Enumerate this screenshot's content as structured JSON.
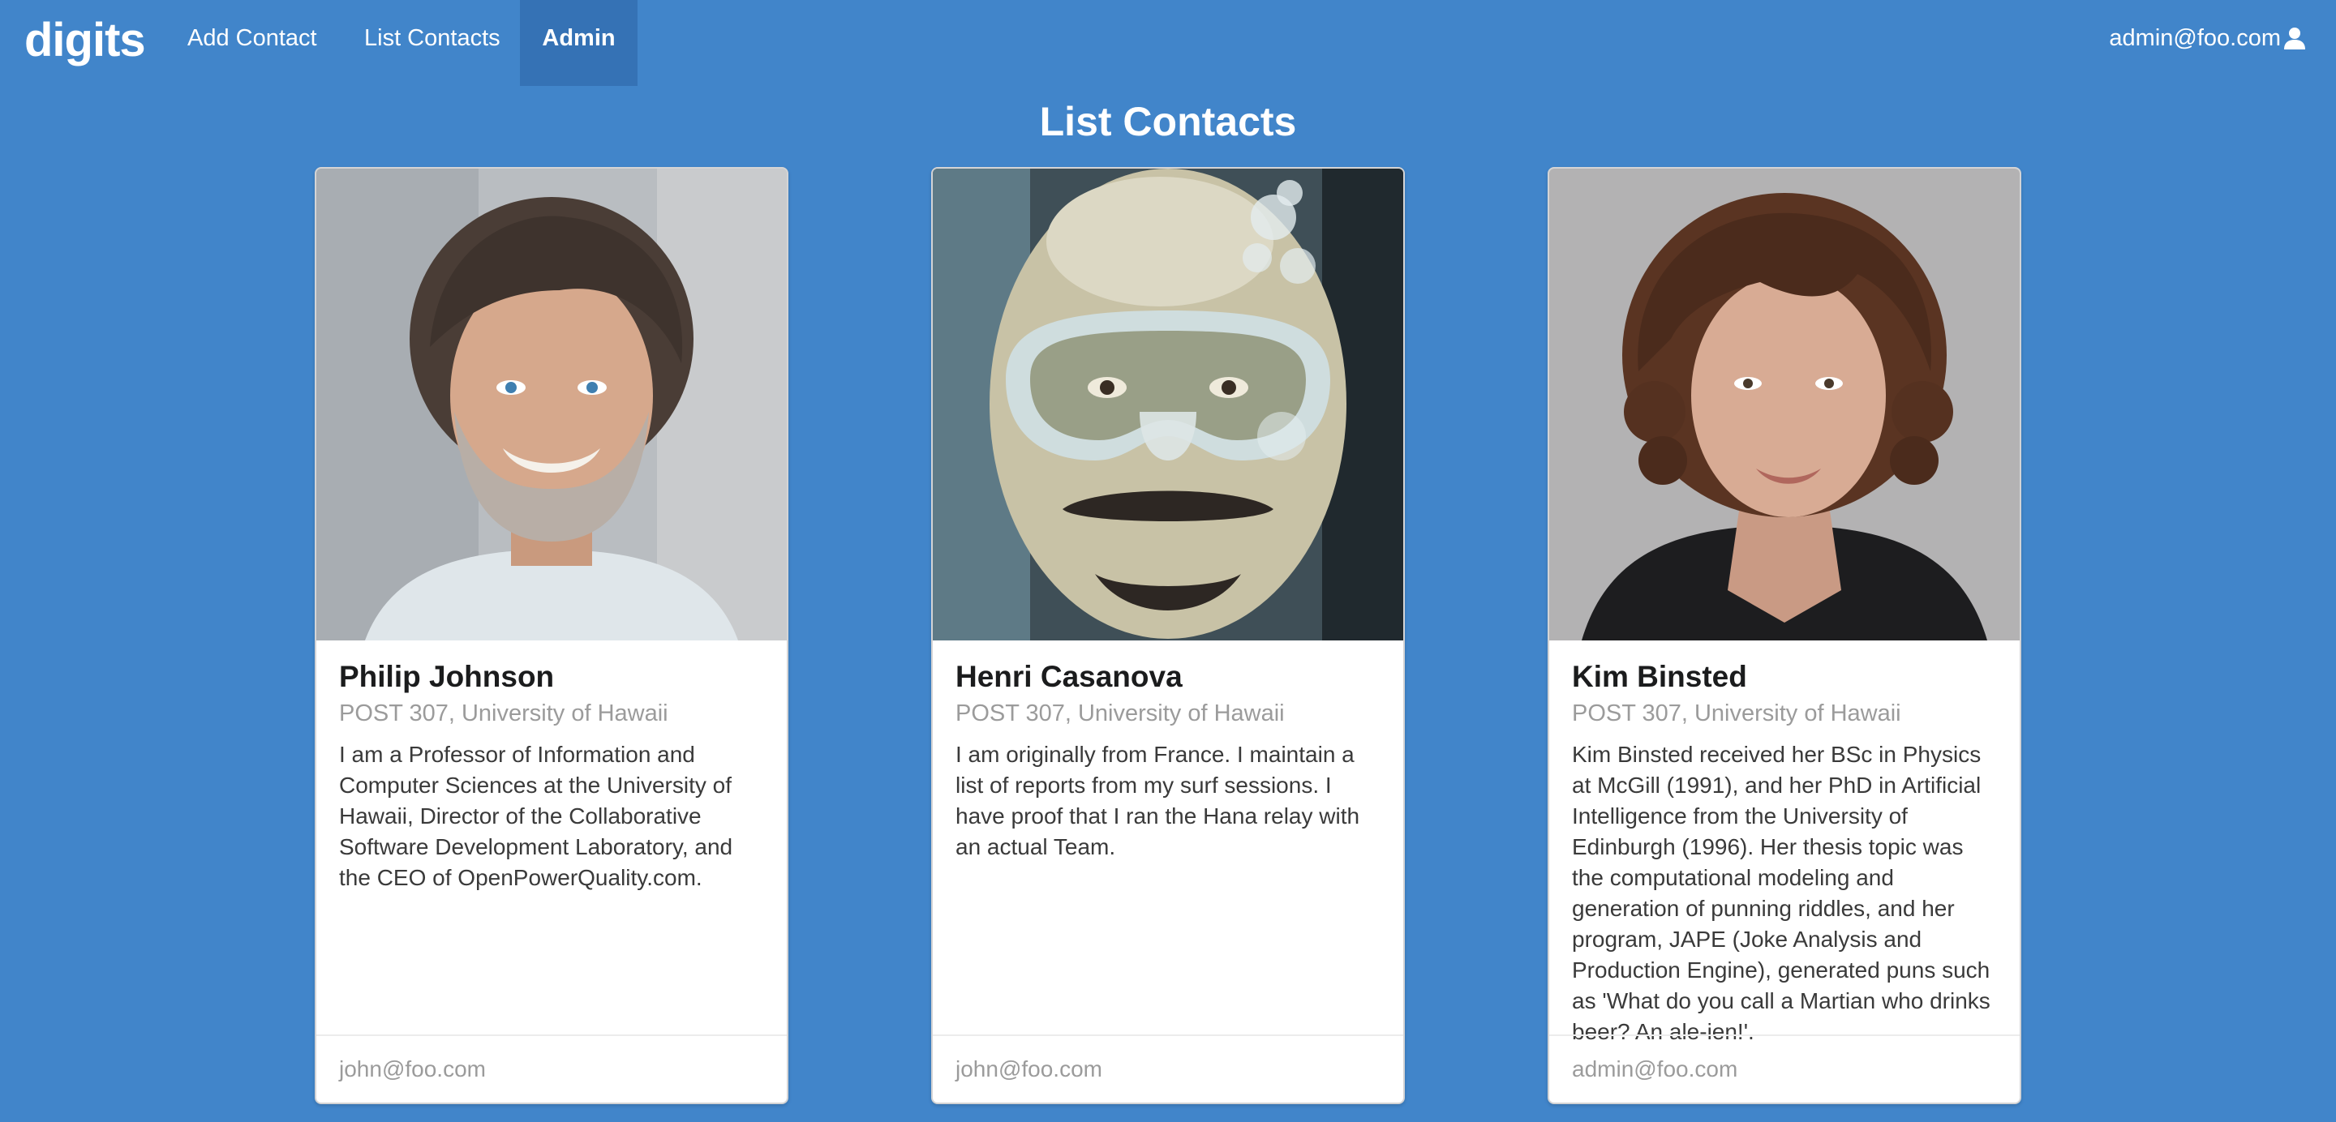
{
  "navbar": {
    "brand": "digits",
    "items": [
      {
        "label": "Add Contact"
      },
      {
        "label": "List Contacts"
      },
      {
        "label": "Admin",
        "active": true
      }
    ],
    "user": {
      "email": "admin@foo.com",
      "icon": "user-icon"
    }
  },
  "page": {
    "title": "List Contacts"
  },
  "contacts": [
    {
      "name": "Philip Johnson",
      "address": "POST 307, University of Hawaii",
      "description": "I am a Professor of Information and Computer Sciences at the University of Hawaii, Director of the Collaborative Software Development Laboratory, and the CEO of OpenPowerQuality.com.",
      "owner": "john@foo.com",
      "photo": "portrait-gray-haired-man"
    },
    {
      "name": "Henri Casanova",
      "address": "POST 307, University of Hawaii",
      "description": "I am originally from France. I maintain a list of reports from my surf sessions. I have proof that I ran the Hana relay with an actual Team.",
      "owner": "john@foo.com",
      "photo": "portrait-diver-with-mask"
    },
    {
      "name": "Kim Binsted",
      "address": "POST 307, University of Hawaii",
      "description": "Kim Binsted received her BSc in Physics at McGill (1991), and her PhD in Artificial Intelligence from the University of Edinburgh (1996). Her thesis topic was the computational modeling and generation of punning riddles, and her program, JAPE (Joke Analysis and Production Engine), generated puns such as 'What do you call a Martian who drinks beer? An ale-ien!'.",
      "owner": "admin@foo.com",
      "photo": "portrait-curly-haired-woman"
    }
  ],
  "colors": {
    "background": "#4185ca",
    "active_nav": "#3572b5",
    "card": "#ffffff",
    "muted_text": "#9b9b9b"
  }
}
